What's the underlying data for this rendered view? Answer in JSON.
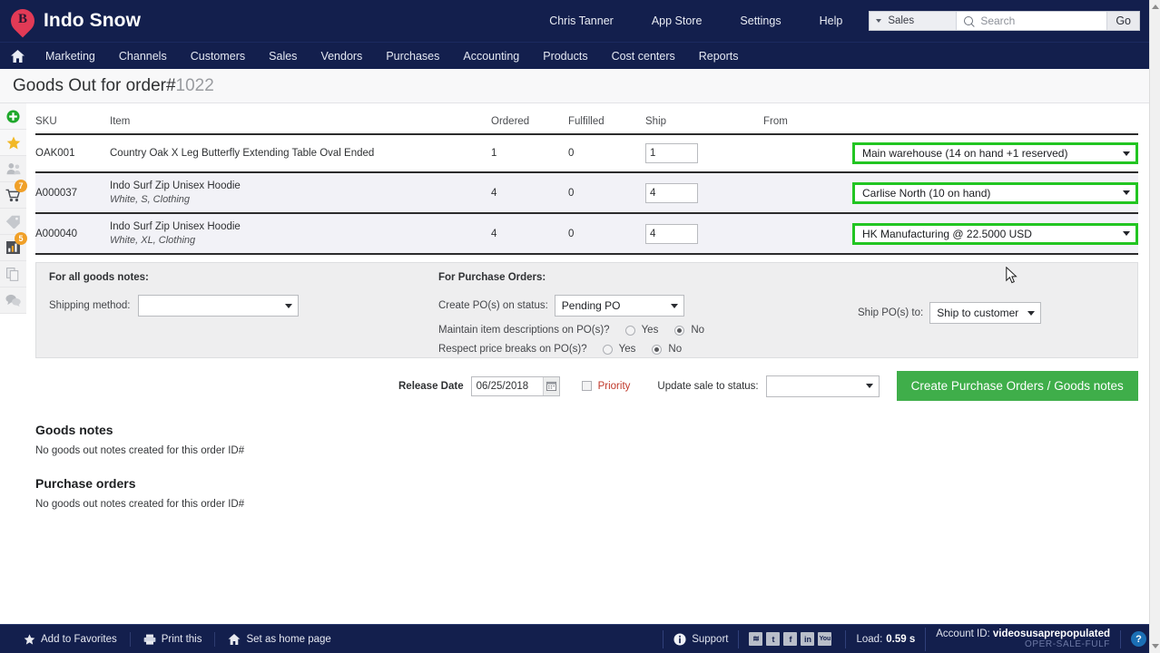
{
  "header": {
    "brand": "Indo Snow",
    "logo_icon": "map-pin-b-logo",
    "links": [
      {
        "label": "Chris Tanner",
        "name": "user-menu"
      },
      {
        "label": "App Store",
        "name": "app-store"
      },
      {
        "label": "Settings",
        "name": "settings"
      },
      {
        "label": "Help",
        "name": "help"
      }
    ],
    "search": {
      "scope": "Sales",
      "placeholder": "Search",
      "value": "",
      "go_label": "Go",
      "search_icon": "magnifier-icon",
      "caret_icon": "caret-down-icon"
    }
  },
  "mainnav": {
    "home_icon": "home-icon",
    "items": [
      "Marketing",
      "Channels",
      "Customers",
      "Sales",
      "Vendors",
      "Purchases",
      "Accounting",
      "Products",
      "Cost centers",
      "Reports"
    ]
  },
  "page": {
    "title_prefix": "Goods Out for order#",
    "order_number": "1022"
  },
  "rail": [
    {
      "name": "add-icon",
      "glyph": "plus-circle",
      "badge": ""
    },
    {
      "name": "favorites-star-icon",
      "glyph": "star",
      "badge": ""
    },
    {
      "name": "customers-icon",
      "glyph": "people",
      "badge": ""
    },
    {
      "name": "cart-icon",
      "glyph": "cart",
      "badge": "7"
    },
    {
      "name": "tag-icon",
      "glyph": "tag",
      "badge": ""
    },
    {
      "name": "reports-chart-icon",
      "glyph": "chart",
      "badge": "5"
    },
    {
      "name": "documents-icon",
      "glyph": "documents",
      "badge": ""
    },
    {
      "name": "chat-icon",
      "glyph": "chat",
      "badge": ""
    }
  ],
  "table": {
    "columns": [
      "SKU",
      "Item",
      "Ordered",
      "Fulfilled",
      "Ship",
      "From"
    ],
    "rows": [
      {
        "sku": "OAK001",
        "item": "Country Oak X Leg Butterfly Extending Table Oval Ended",
        "variant": "",
        "ordered": "1",
        "fulfilled": "0",
        "ship": "1",
        "from": "Main warehouse (14 on hand +1 reserved)",
        "highlight_color": "#22c522"
      },
      {
        "sku": "A000037",
        "item": "Indo Surf Zip Unisex Hoodie",
        "variant": "White, S, Clothing",
        "ordered": "4",
        "fulfilled": "0",
        "ship": "4",
        "from": "Carlise North (10 on hand)",
        "highlight_color": "#22c522"
      },
      {
        "sku": "A000040",
        "item": "Indo Surf Zip Unisex Hoodie",
        "variant": "White, XL, Clothing",
        "ordered": "4",
        "fulfilled": "0",
        "ship": "4",
        "from": "HK Manufacturing @ 22.5000 USD",
        "highlight_color": "#22c522"
      }
    ]
  },
  "options": {
    "goods_notes_heading": "For all goods notes:",
    "shipping_method_label": "Shipping method:",
    "shipping_method_value": "",
    "po_heading": "For Purchase Orders:",
    "create_po_label": "Create PO(s) on status:",
    "create_po_value": "Pending PO",
    "maintain_label": "Maintain item descriptions on PO(s)?",
    "maintain_yes": "Yes",
    "maintain_no": "No",
    "maintain_selected": "No",
    "respect_label": "Respect price breaks on PO(s)?",
    "respect_yes": "Yes",
    "respect_no": "No",
    "respect_selected": "No",
    "ship_po_label": "Ship PO(s) to:",
    "ship_po_value": "Ship to customer"
  },
  "actions": {
    "release_date_label": "Release Date",
    "release_date_value": "06/25/2018",
    "calendar_icon": "calendar-icon",
    "priority_label": "Priority",
    "priority_checked": false,
    "update_status_label": "Update sale to status:",
    "update_status_value": "",
    "create_button": "Create Purchase Orders / Goods notes",
    "create_button_color": "#3fae4a"
  },
  "sections": [
    {
      "heading": "Goods notes",
      "body": "No goods out notes created for this order ID#"
    },
    {
      "heading": "Purchase orders",
      "body": "No goods out notes created for this order ID#"
    }
  ],
  "footer": {
    "left_links": [
      {
        "label": "Add to Favorites",
        "icon": "star-icon"
      },
      {
        "label": "Print this",
        "icon": "printer-icon"
      },
      {
        "label": "Set as home page",
        "icon": "home-icon"
      }
    ],
    "support_label": "Support",
    "support_icon": "info-icon",
    "social": [
      {
        "name": "rss-icon",
        "glyph": "◠"
      },
      {
        "name": "twitter-icon",
        "glyph": "t"
      },
      {
        "name": "facebook-icon",
        "glyph": "f"
      },
      {
        "name": "linkedin-icon",
        "glyph": "in"
      },
      {
        "name": "youtube-icon",
        "glyph": "▶"
      }
    ],
    "load_label": "Load:",
    "load_value": "0.59 s",
    "account_label": "Account ID:",
    "account_value": "videosusaprepopulated",
    "account_sub": "OPER-SALE-FULF",
    "help_icon": "question-icon"
  }
}
